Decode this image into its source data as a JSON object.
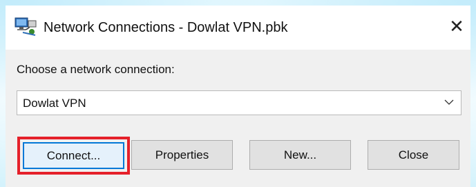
{
  "window": {
    "title": "Network Connections - Dowlat VPN.pbk",
    "icon": "network-connections-icon",
    "close_glyph": "✕"
  },
  "dialog": {
    "prompt_label": "Choose a network connection:",
    "selected_connection": "Dowlat VPN"
  },
  "buttons": {
    "connect": "Connect...",
    "properties": "Properties",
    "new": "New...",
    "close": "Close"
  },
  "colors": {
    "highlight_border": "#e5202a",
    "focus_border": "#0078d7",
    "dialog_background": "#f0f0f0",
    "button_face": "#e1e1e1"
  }
}
